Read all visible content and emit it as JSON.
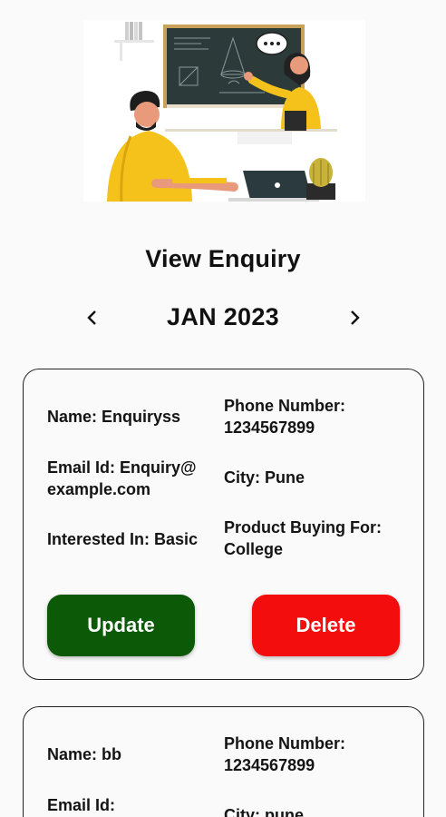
{
  "page": {
    "title": "View Enquiry"
  },
  "month_nav": {
    "label": "JAN 2023",
    "prev_icon": "chevron-left-icon",
    "next_icon": "chevron-right-icon"
  },
  "enquiries": [
    {
      "name": "Name: Enquiryss",
      "phone_label": "Phone Number:",
      "phone": "1234567899",
      "email_label": "Email Id: Enquiry@",
      "email_cont": "example.com",
      "city": "City: Pune",
      "interested": "Interested In: Basic",
      "buying_label": "Product Buying For:",
      "buying": "College",
      "update_label": "Update",
      "delete_label": "Delete"
    },
    {
      "name": "Name: bb",
      "phone_label": "Phone Number:",
      "phone": "1234567899",
      "email_label": "Email Id:",
      "city": "City: pune"
    }
  ],
  "colors": {
    "update": "#0c5a08",
    "delete": "#f40d0d",
    "accent_yellow": "#f4c21a",
    "board": "#2d3a3a"
  }
}
